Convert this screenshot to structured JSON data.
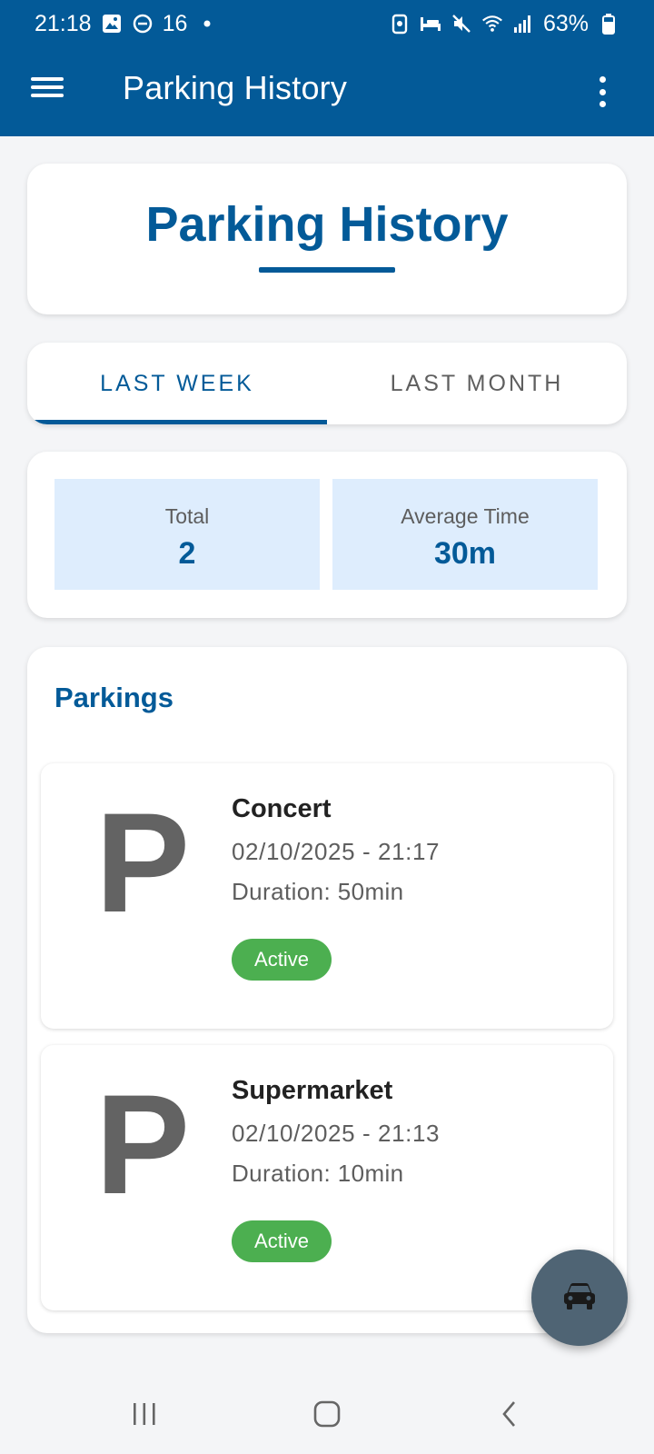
{
  "status_bar": {
    "time": "21:18",
    "temperature": "16",
    "battery": "63%"
  },
  "app_bar": {
    "title": "Parking History"
  },
  "header": {
    "title": "Parking History"
  },
  "tabs": [
    {
      "label": "LAST WEEK",
      "selected": true
    },
    {
      "label": "LAST MONTH",
      "selected": false
    }
  ],
  "stats": {
    "total_label": "Total",
    "total_value": "2",
    "avg_label": "Average Time",
    "avg_value": "30m"
  },
  "parkings": {
    "title": "Parkings",
    "items": [
      {
        "icon_letter": "P",
        "name": "Concert",
        "datetime": "02/10/2025 - 21:17",
        "duration": "Duration: 50min",
        "status": "Active"
      },
      {
        "icon_letter": "P",
        "name": "Supermarket",
        "datetime": "02/10/2025 - 21:13",
        "duration": "Duration: 10min",
        "status": "Active"
      }
    ]
  },
  "colors": {
    "primary": "#035a98",
    "stat_bg": "#deedfd",
    "active": "#4caf50",
    "fab": "#4f6474"
  },
  "icons": {
    "menu": "hamburger-menu-icon",
    "overflow": "more-vert-icon",
    "fab": "car-icon",
    "nav_recent": "recent-apps-icon",
    "nav_home": "home-icon",
    "nav_back": "back-icon"
  }
}
